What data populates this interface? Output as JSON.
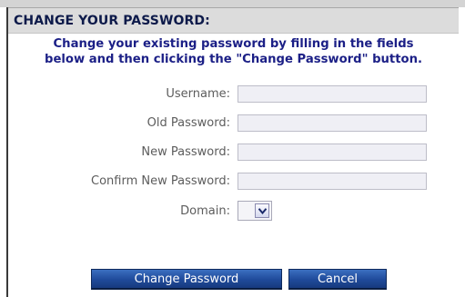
{
  "panel": {
    "title": "CHANGE YOUR PASSWORD:",
    "instructions_line1": "Change your existing password by filling in the fields",
    "instructions_line2": "below and then clicking the \"Change Password\" button."
  },
  "form": {
    "username": {
      "label": "Username:",
      "value": ""
    },
    "old_password": {
      "label": "Old Password:",
      "value": ""
    },
    "new_password": {
      "label": "New Password:",
      "value": ""
    },
    "confirm_password": {
      "label": "Confirm New Password:",
      "value": ""
    },
    "domain": {
      "label": "Domain:",
      "selected": ""
    }
  },
  "buttons": {
    "change_password": "Change Password",
    "cancel": "Cancel"
  },
  "colors": {
    "title_text": "#0d1a4a",
    "instructions_text": "#1b1f86",
    "label_text": "#5c5c5c",
    "field_bg": "#efeff5",
    "button_bg": "#1f4a9a"
  },
  "icons": {
    "domain_dropdown": "chevron-down-icon"
  }
}
